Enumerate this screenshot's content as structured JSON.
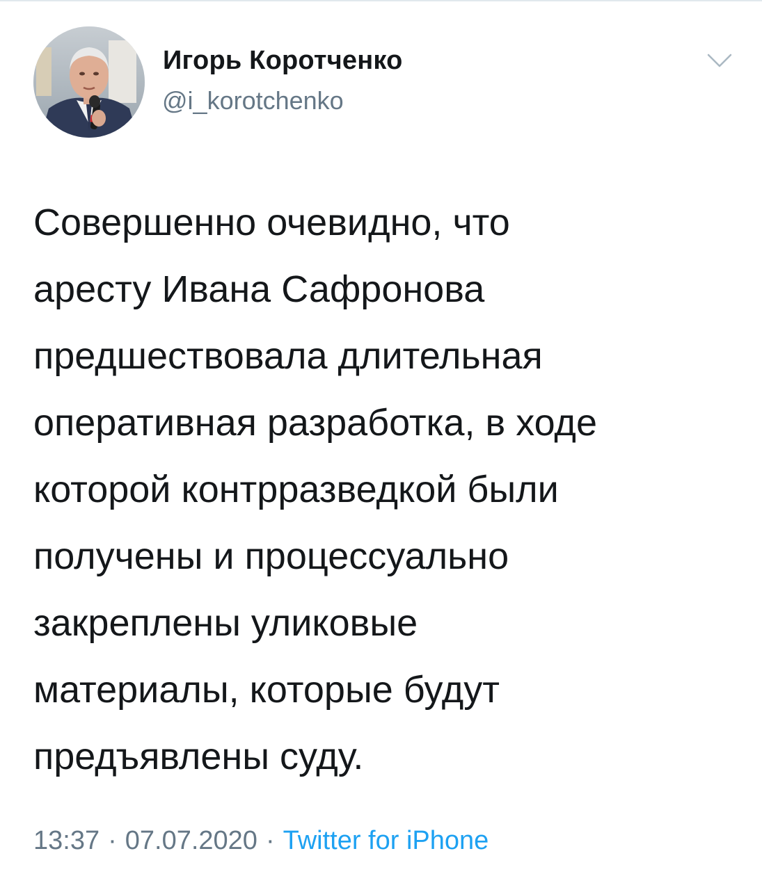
{
  "author": {
    "name": "Игорь Коротченко",
    "handle": "@i_korotchenko"
  },
  "tweet": {
    "lines": [
      "Совершенно очевидно, что",
      "аресту Ивана Сафронова",
      "предшествовала длительная",
      "оперативная разработка, в ходе",
      "которой контрразведкой были",
      "получены и процессуально",
      "закреплены уликовые",
      "материалы, которые будут",
      "предъявлены суду."
    ]
  },
  "meta": {
    "time": "13:37",
    "separator": "·",
    "date": "07.07.2020",
    "source": "Twitter for iPhone"
  },
  "icons": {
    "menu": "chevron-down-icon"
  },
  "colors": {
    "text": "#14171a",
    "secondary": "#657786",
    "link": "#1da1f2",
    "divider": "#e1e8ed"
  }
}
